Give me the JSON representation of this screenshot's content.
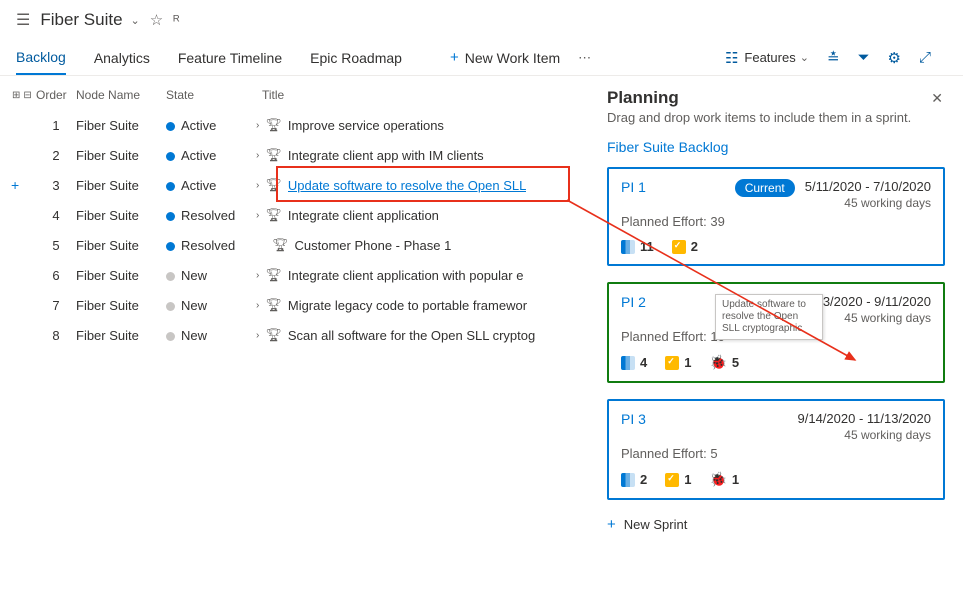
{
  "header": {
    "title": "Fiber Suite"
  },
  "tabs": {
    "items": [
      {
        "label": "Backlog",
        "active": true
      },
      {
        "label": "Analytics"
      },
      {
        "label": "Feature Timeline"
      },
      {
        "label": "Epic Roadmap"
      }
    ],
    "newWorkItem": "New Work Item",
    "filterLabel": "Features"
  },
  "gridHeader": {
    "order": "Order",
    "node": "Node Name",
    "state": "State",
    "title": "Title"
  },
  "rows": [
    {
      "order": "1",
      "node": "Fiber Suite",
      "state": "Active",
      "stateColor": "#0078d4",
      "title": "Improve service operations",
      "hasChev": true
    },
    {
      "order": "2",
      "node": "Fiber Suite",
      "state": "Active",
      "stateColor": "#0078d4",
      "title": "Integrate client app with IM clients",
      "hasChev": true
    },
    {
      "order": "3",
      "node": "Fiber Suite",
      "state": "Active",
      "stateColor": "#0078d4",
      "title": "Update software to resolve the Open SLL",
      "hasChev": true,
      "selected": true
    },
    {
      "order": "4",
      "node": "Fiber Suite",
      "state": "Resolved",
      "stateColor": "#0078d4",
      "title": "Integrate client application",
      "hasChev": true
    },
    {
      "order": "5",
      "node": "Fiber Suite",
      "state": "Resolved",
      "stateColor": "#0078d4",
      "title": "Customer Phone - Phase 1",
      "hasChev": false
    },
    {
      "order": "6",
      "node": "Fiber Suite",
      "state": "New",
      "stateColor": "#c8c6c4",
      "title": "Integrate client application with popular e",
      "hasChev": true
    },
    {
      "order": "7",
      "node": "Fiber Suite",
      "state": "New",
      "stateColor": "#c8c6c4",
      "title": "Migrate legacy code to portable framewor",
      "hasChev": true
    },
    {
      "order": "8",
      "node": "Fiber Suite",
      "state": "New",
      "stateColor": "#c8c6c4",
      "title": "Scan all software for the Open SLL cryptog",
      "hasChev": true
    }
  ],
  "panel": {
    "title": "Planning",
    "subtitle": "Drag and drop work items to include them in a sprint.",
    "backlogLink": "Fiber Suite Backlog",
    "newSprint": "New Sprint",
    "dragGhost": "Update software to resolve the Open SLL cryptographic",
    "currentLabel": "Current"
  },
  "sprints": [
    {
      "name": "PI 1",
      "current": true,
      "dates": "5/11/2020 - 7/10/2020",
      "working": "45 working days",
      "effort": "Planned Effort: 39",
      "blueCt": "11",
      "yelCt": "2",
      "bugCt": null,
      "color": "blue"
    },
    {
      "name": "PI 2",
      "current": false,
      "dates": "7/13/2020 - 9/11/2020",
      "working": "45 working days",
      "effort": "Planned Effort: 10",
      "blueCt": "4",
      "yelCt": "1",
      "bugCt": "5",
      "color": "green"
    },
    {
      "name": "PI 3",
      "current": false,
      "dates": "9/14/2020 - 11/13/2020",
      "working": "45 working days",
      "effort": "Planned Effort: 5",
      "blueCt": "2",
      "yelCt": "1",
      "bugCt": "1",
      "color": "blue"
    }
  ]
}
